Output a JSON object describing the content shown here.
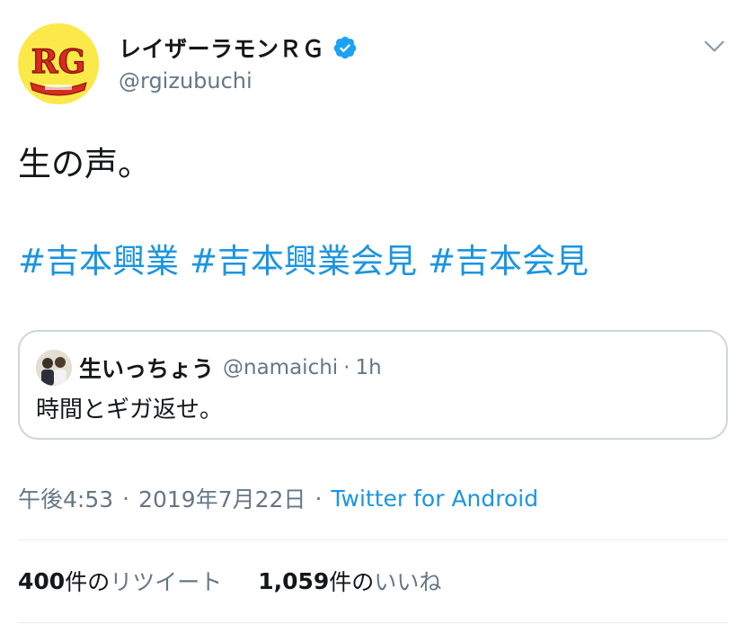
{
  "author": {
    "display_name": "レイザーラモンＲＧ",
    "handle": "@rgizubuchi",
    "verified": true,
    "avatar_text": "RG"
  },
  "tweet": {
    "text": "生の声。",
    "hashtags": [
      "#吉本興業",
      "#吉本興業会見",
      "#吉本会見"
    ]
  },
  "quoted": {
    "display_name": "生いっちょう",
    "handle": "@namaichi",
    "separator": "·",
    "time": "1h",
    "text": "時間とギガ返せ。"
  },
  "meta": {
    "time": "午後4:53",
    "separator": "·",
    "date": "2019年7月22日",
    "source": "Twitter for Android"
  },
  "stats": {
    "retweets_count": "400",
    "retweets_unit": "件の",
    "retweets_label": "リツイート",
    "likes_count": "1,059",
    "likes_unit": "件の",
    "likes_label": "いいね"
  },
  "colors": {
    "link": "#1b95e0",
    "secondary_text": "#657786",
    "verified": "#1da1f2",
    "border": "#ccd6dd",
    "avatar_bg": "#fbe94a"
  },
  "icons": {
    "verified": "verified-badge-icon",
    "menu": "chevron-down-icon"
  }
}
